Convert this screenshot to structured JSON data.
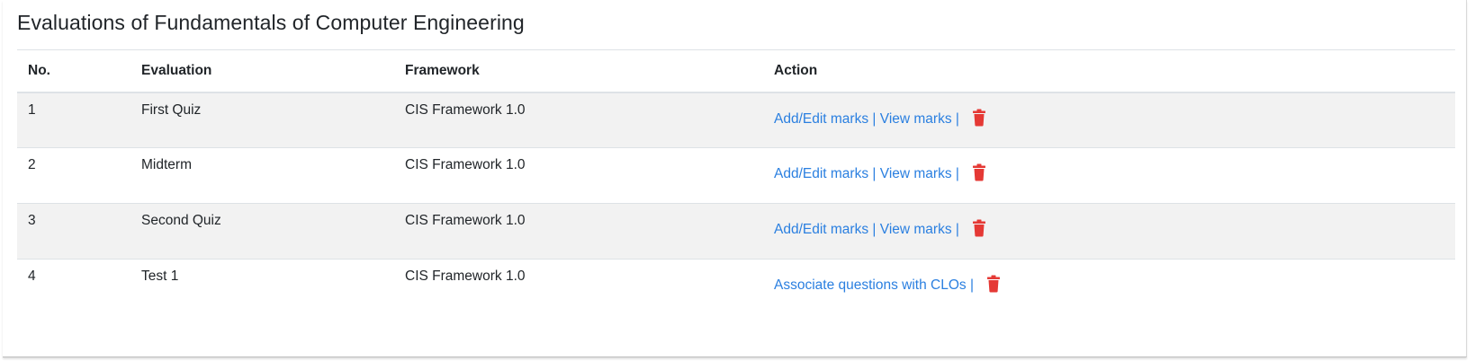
{
  "page_title": "Evaluations of Fundamentals of Computer Engineering",
  "table": {
    "headers": {
      "no": "No.",
      "evaluation": "Evaluation",
      "framework": "Framework",
      "action": "Action"
    },
    "rows": [
      {
        "no": "1",
        "evaluation": "First Quiz",
        "framework": "CIS Framework 1.0",
        "actions": [
          "Add/Edit marks",
          "View marks"
        ]
      },
      {
        "no": "2",
        "evaluation": "Midterm",
        "framework": "CIS Framework 1.0",
        "actions": [
          "Add/Edit marks",
          "View marks"
        ]
      },
      {
        "no": "3",
        "evaluation": "Second Quiz",
        "framework": "CIS Framework 1.0",
        "actions": [
          "Add/Edit marks",
          "View marks"
        ]
      },
      {
        "no": "4",
        "evaluation": "Test 1",
        "framework": "CIS Framework 1.0",
        "actions": [
          "Associate questions with CLOs"
        ]
      }
    ],
    "separator": "|",
    "delete_icon": "trash-icon"
  },
  "colors": {
    "link": "#2a7fe0",
    "delete": "#e53935",
    "stripe": "#f2f2f2"
  }
}
